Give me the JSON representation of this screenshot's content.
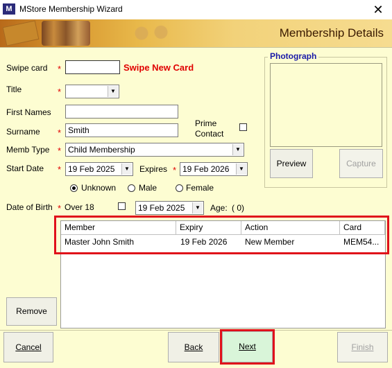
{
  "window": {
    "title": "MStore Membership Wizard",
    "icon_text": "M",
    "close_glyph": "✕"
  },
  "banner": {
    "title": "Membership Details"
  },
  "form": {
    "swipe_label": "Swipe card",
    "swipe_value": "",
    "swipe_new_card": "Swipe New Card",
    "title_label": "Title",
    "title_value": "",
    "first_names_label": "First Names",
    "first_names_value": "",
    "surname_label": "Surname",
    "surname_value": "Smith",
    "prime_contact_label_1": "Prime",
    "prime_contact_label_2": "Contact",
    "memb_type_label": "Memb Type",
    "memb_type_value": "Child Membership",
    "start_date_label": "Start Date",
    "start_date_value": "19 Feb 2025",
    "expires_label": "Expires",
    "expires_value": "19 Feb 2026",
    "gender_unknown": "Unknown",
    "gender_male": "Male",
    "gender_female": "Female",
    "dob_label": "Date of Birth",
    "over18_label": "Over 18",
    "dob_value": "19 Feb 2025",
    "age_label": "Age:",
    "age_value": "( 0)",
    "required_mark": "*"
  },
  "photo": {
    "group_title": "Photograph",
    "preview": "Preview",
    "capture": "Capture"
  },
  "grid": {
    "headers": [
      "Member",
      "Expiry",
      "Action",
      "Card"
    ],
    "rows": [
      [
        "Master John Smith",
        "19 Feb 2026",
        "New Member",
        "MEM54..."
      ]
    ]
  },
  "buttons": {
    "remove": "Remove",
    "cancel": "Cancel",
    "back": "Back",
    "next": "Next",
    "finish": "Finish"
  }
}
